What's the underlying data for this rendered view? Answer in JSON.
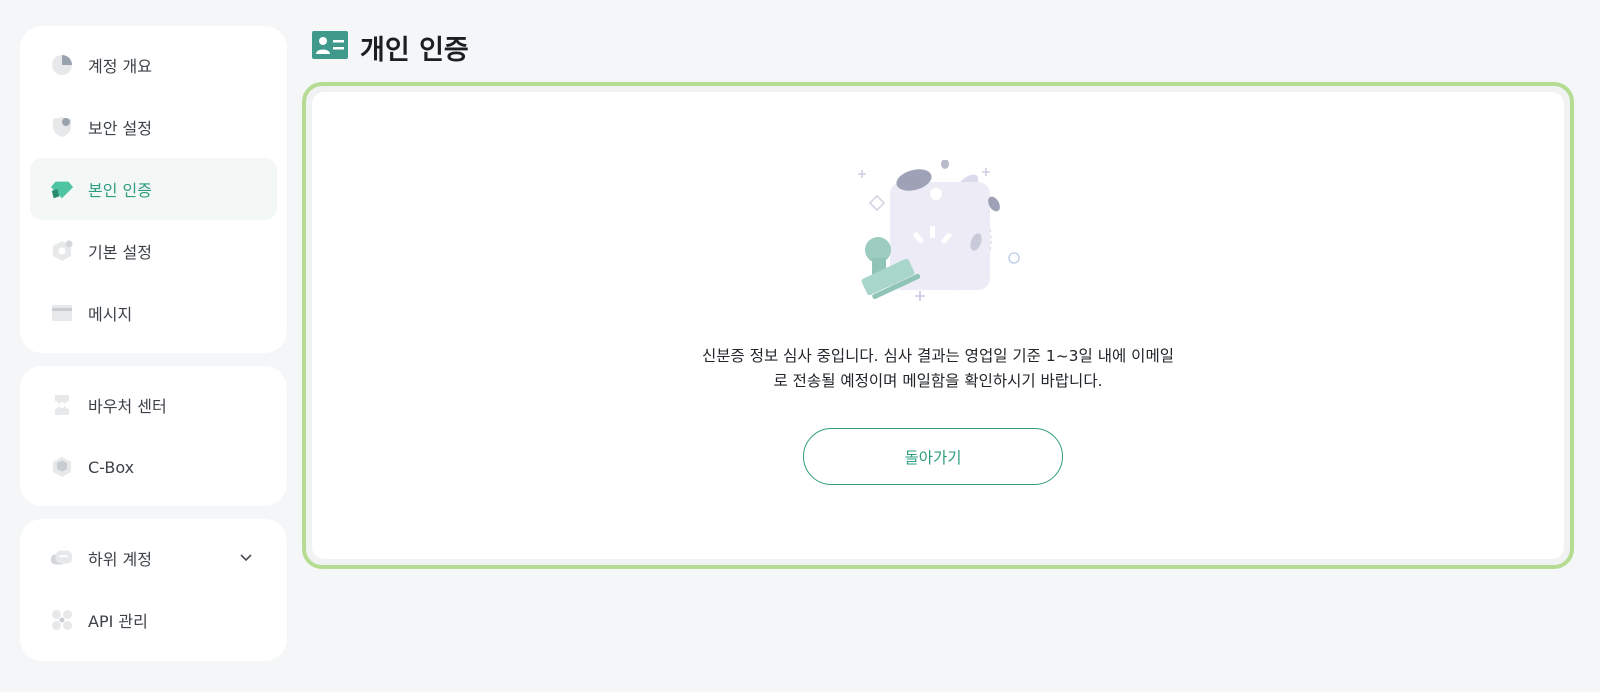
{
  "sidebar": {
    "groups": [
      {
        "items": [
          {
            "label": "계정 개요",
            "icon": "pie-chart-icon"
          },
          {
            "label": "보안 설정",
            "icon": "shield-icon"
          },
          {
            "label": "본인 인증",
            "icon": "diamond-badge-icon",
            "active": true
          },
          {
            "label": "기본 설정",
            "icon": "hexagon-settings-icon"
          },
          {
            "label": "메시지",
            "icon": "envelope-icon"
          }
        ]
      },
      {
        "items": [
          {
            "label": "바우처 센터",
            "icon": "voucher-icon"
          },
          {
            "label": "C-Box",
            "icon": "box-icon"
          }
        ]
      },
      {
        "items": [
          {
            "label": "하위 계정",
            "icon": "stack-icon",
            "expandable": true
          },
          {
            "label": "API 관리",
            "icon": "api-grid-icon"
          }
        ]
      }
    ]
  },
  "main": {
    "title": "개인 인증",
    "title_icon": "id-card-icon",
    "message_line1": "신분증 정보 심사 중입니다. 심사 결과는 영업일 기준 1~3일 내에 이메일",
    "message_line2": "로 전송될 예정이며 메일함을 확인하시기 바랍니다.",
    "back_button": "돌아가기"
  },
  "colors": {
    "accent": "#2f9e7f",
    "highlight_border": "#b5dc92",
    "page_bg": "#f5f6f7",
    "title_icon_bg": "#3f9a8c"
  }
}
